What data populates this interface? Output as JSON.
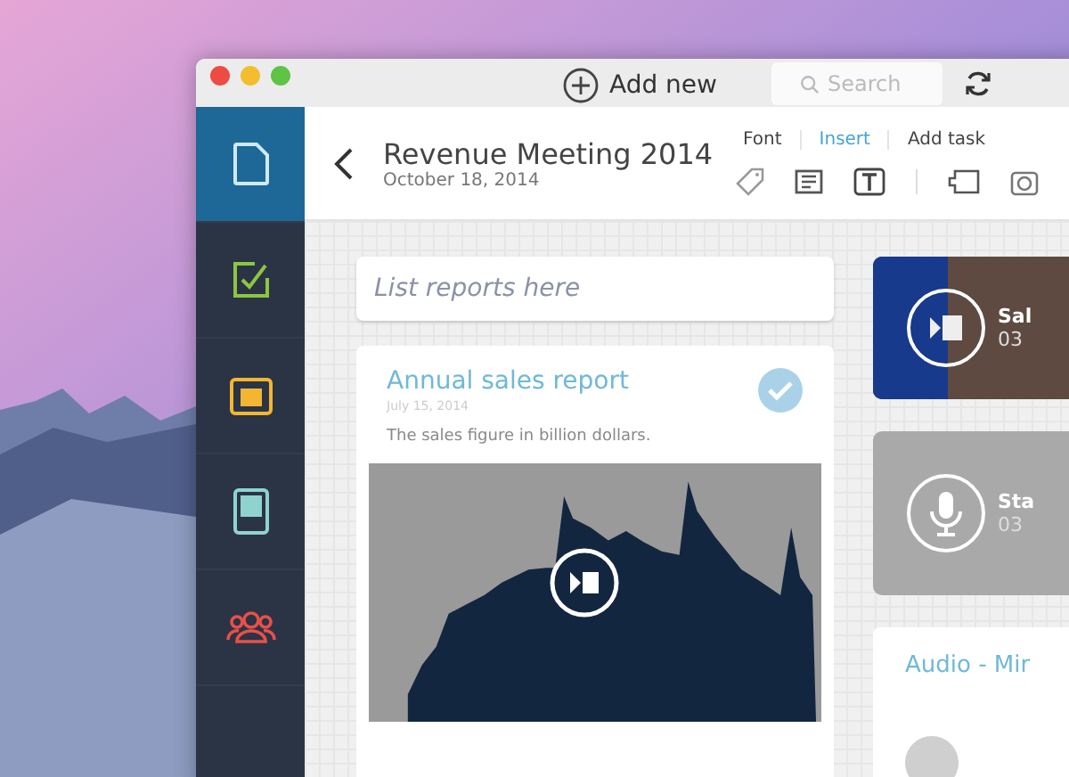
{
  "toolbar": {
    "add_button": "Add new",
    "search": {
      "placeholder": "Search"
    }
  },
  "sidebar": {
    "items": [
      {
        "kind": "note",
        "selected": true,
        "color": "#cfe9f7"
      },
      {
        "kind": "tasks",
        "selected": false,
        "color": "#8dc63f"
      },
      {
        "kind": "calendar",
        "selected": false,
        "color": "#f2b632"
      },
      {
        "kind": "grid",
        "selected": false,
        "color": "#8fd3cf"
      },
      {
        "kind": "people",
        "selected": false,
        "color": "#e8504a"
      }
    ]
  },
  "document": {
    "title": "Revenue Meeting 2014",
    "date": "October 18, 2014"
  },
  "tabs": [
    {
      "label": "Font",
      "selected": false
    },
    {
      "label": "Insert",
      "selected": true
    },
    {
      "label": "Add task",
      "selected": false
    }
  ],
  "list_search": {
    "placeholder": "List reports here"
  },
  "report_card": {
    "title": "Annual sales report",
    "date": "July 15, 2014",
    "description": "The sales figure in billion dollars.",
    "checked": true
  },
  "media_cards": [
    {
      "kind": "video",
      "title": "Sal",
      "subtitle": "03"
    },
    {
      "kind": "audio",
      "title": "Sta",
      "subtitle": "03"
    }
  ],
  "audio_card": {
    "title": "Audio - Mir"
  }
}
